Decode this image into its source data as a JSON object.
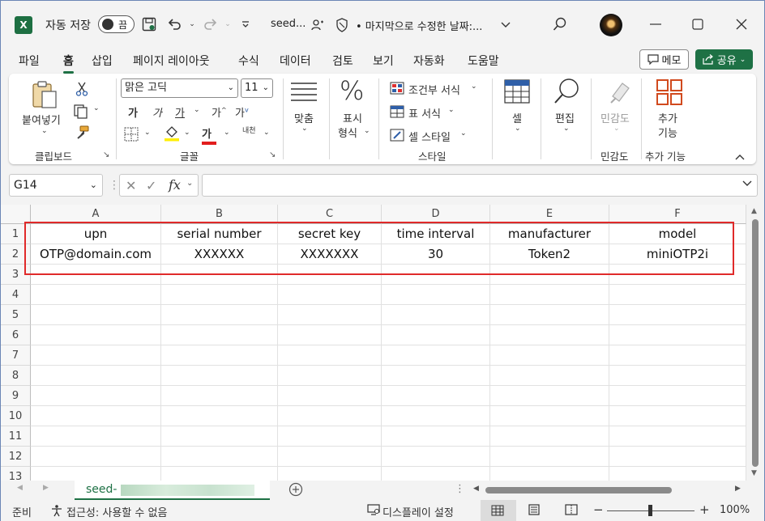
{
  "titlebar": {
    "autosave_label": "자동 저장",
    "autosave_state": "끔",
    "filename": "seed...",
    "save_status": "• 마지막으로 수정한 날짜:...",
    "app_icon_letter": "X"
  },
  "menu": {
    "tabs": [
      "파일",
      "홈",
      "삽입",
      "페이지 레이아웃",
      "수식",
      "데이터",
      "검토",
      "보기",
      "자동화",
      "도움말"
    ],
    "active_tab": "홈",
    "memo_label": "메모",
    "share_label": "공유"
  },
  "ribbon": {
    "clipboard": {
      "paste_label": "붙여넣기",
      "group_label": "클립보드"
    },
    "font": {
      "font_name": "맑은 고딕",
      "font_size": "11",
      "bold": "가",
      "italic": "가",
      "underline": "가",
      "grow": "가",
      "shrink": "가",
      "font_color_glyph": "가",
      "phonetic": "내천",
      "group_label": "글꼴"
    },
    "alignment": {
      "label": "맞춤"
    },
    "number": {
      "label_line1": "표시",
      "label_line2": "형식",
      "glyph": "%"
    },
    "styles": {
      "conditional": "조건부 서식",
      "table": "표 서식",
      "cell_style": "셀 스타일",
      "group_label": "스타일"
    },
    "cells": {
      "label": "셀"
    },
    "editing": {
      "label": "편집"
    },
    "sensitivity": {
      "label": "민감도",
      "group_label": "민감도"
    },
    "addins": {
      "label_line1": "추가",
      "label_line2": "기능",
      "group_label": "추가 기능"
    }
  },
  "formula_bar": {
    "name_box": "G14",
    "fx": "fx",
    "formula": ""
  },
  "grid": {
    "columns": [
      "A",
      "B",
      "C",
      "D",
      "E",
      "F"
    ],
    "rows": [
      "1",
      "2",
      "3",
      "4",
      "5",
      "6",
      "7",
      "8",
      "9",
      "10",
      "11",
      "12",
      "13"
    ],
    "cells": [
      [
        "upn",
        "serial number",
        "secret key",
        "time interval",
        "manufacturer",
        "model"
      ],
      [
        "OTP@domain.com",
        "XXXXXX",
        "XXXXXXX",
        "30",
        "Token2",
        "miniOTP2i"
      ]
    ]
  },
  "sheets": {
    "active_tab": "seed-"
  },
  "statusbar": {
    "ready": "준비",
    "accessibility": "접근성: 사용할 수 없음",
    "display_settings": "디스플레이 설정",
    "zoom": "100%"
  },
  "colors": {
    "accent": "#1e7145",
    "highlight_border": "#e02a2a"
  }
}
